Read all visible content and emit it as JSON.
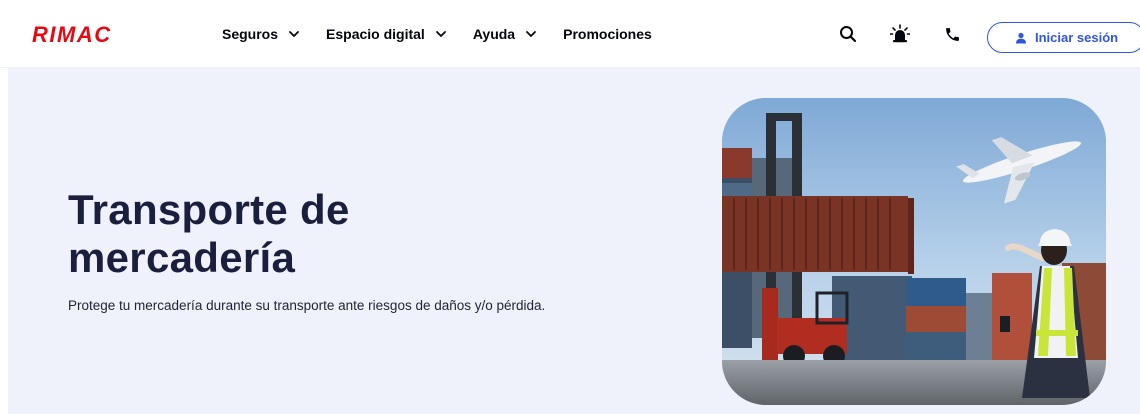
{
  "brand": {
    "logo": "RIMAC",
    "color": "#e50914"
  },
  "nav": {
    "items": [
      {
        "label": "Seguros",
        "has_dropdown": true
      },
      {
        "label": "Espacio digital",
        "has_dropdown": true
      },
      {
        "label": "Ayuda",
        "has_dropdown": true
      },
      {
        "label": "Promociones",
        "has_dropdown": false
      }
    ],
    "icons": [
      "search-icon",
      "alert-siren-icon",
      "phone-icon"
    ],
    "login": {
      "label": "Iniciar sesión",
      "icon": "user-icon",
      "color": "#2f56e0"
    }
  },
  "hero": {
    "title_line1": "Transporte de",
    "title_line2": "mercadería",
    "subtitle": "Protege tu mercadería durante su transporte ante riesgos de daños y/o pérdida.",
    "background": "#eff1fb",
    "image": "cargo-port-airplane-photo"
  }
}
